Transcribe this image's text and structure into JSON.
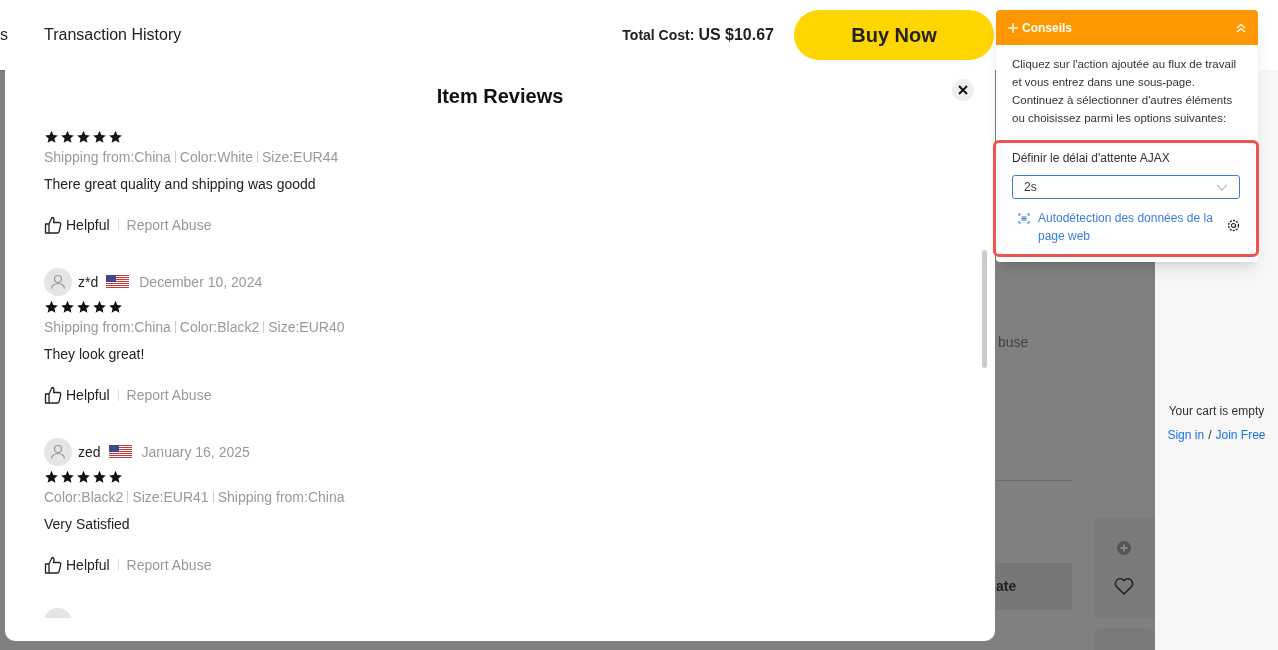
{
  "header": {
    "nav": [
      {
        "label": "s"
      },
      {
        "label": "Transaction History"
      }
    ],
    "total_label": "Total Cost:",
    "total_value": "US $10.67",
    "buy_button": "Buy Now"
  },
  "background": {
    "report_fragment": "buse",
    "column_fragment": "ate"
  },
  "cart": {
    "message": "Your cart is empty",
    "sign_in": "Sign in",
    "separator": "/",
    "join": "Join Free"
  },
  "reviews_dialog": {
    "title": "Item Reviews",
    "reviews": [
      {
        "stars": 5,
        "attributes": [
          "Shipping from:China",
          "Color:White",
          "Size:EUR44"
        ],
        "text": "There great quality and shipping was goodd",
        "helpful": "Helpful",
        "report": "Report Abuse"
      },
      {
        "user": "z*d",
        "date": "December 10, 2024",
        "stars": 5,
        "attributes": [
          "Shipping from:China",
          "Color:Black2",
          "Size:EUR40"
        ],
        "text": "They look great!",
        "helpful": "Helpful",
        "report": "Report Abuse"
      },
      {
        "user": "zed",
        "date": "January 16, 2025",
        "stars": 5,
        "attributes": [
          "Color:Black2",
          "Size:EUR41",
          "Shipping from:China"
        ],
        "text": "Very Satisfied",
        "helpful": "Helpful",
        "report": "Report Abuse"
      }
    ]
  },
  "tips_panel": {
    "title": "Conseils",
    "body": "Cliquez sur l'action ajoutée au flux de travail et vous entrez dans une sous-page. Continuez à sélectionner d'autres éléments ou choisissez parmi les options suivantes:",
    "ajax_label": "Définir le délai d'attente AJAX",
    "ajax_value": "2s",
    "auto_detect": "Autodétection des données de la page web"
  }
}
